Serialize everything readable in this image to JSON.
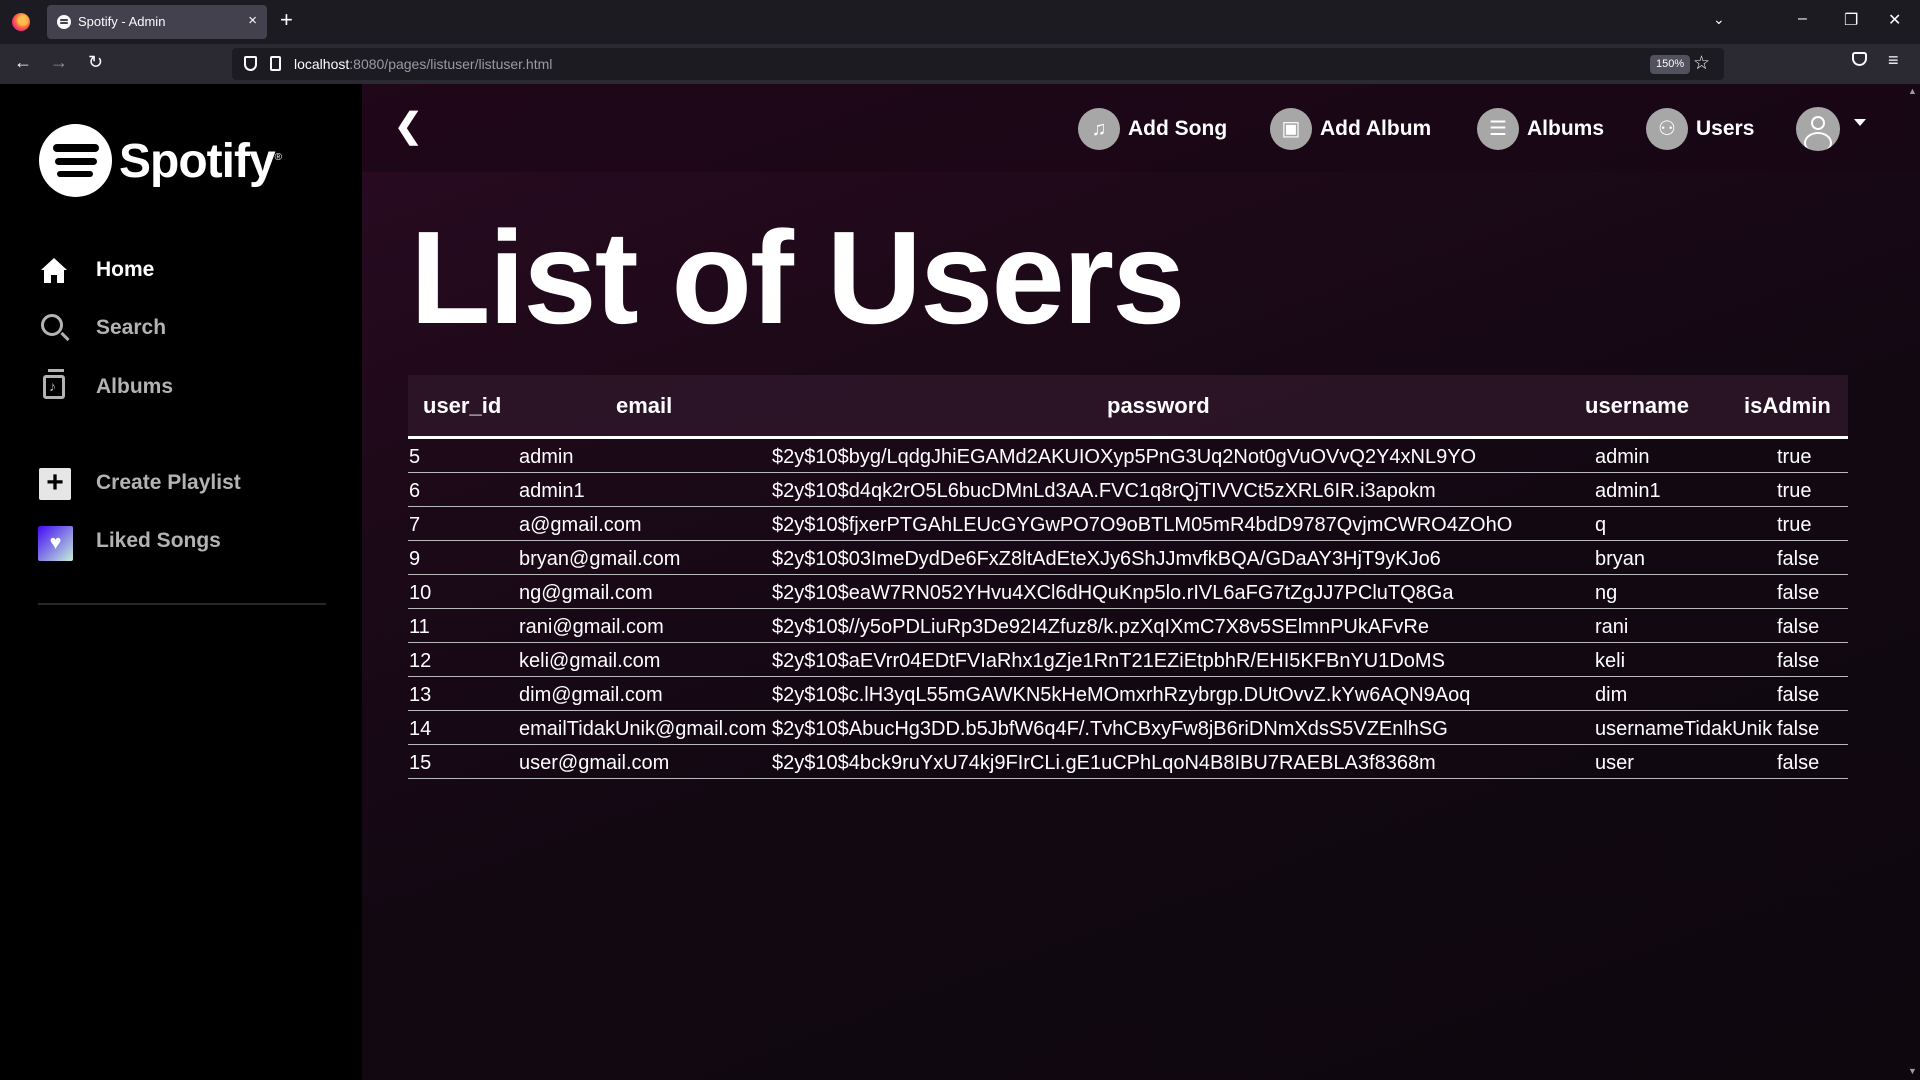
{
  "browser": {
    "tab_title": "Spotify - Admin",
    "url_host": "localhost",
    "url_rest": ":8080/pages/listuser/listuser.html",
    "zoom": "150%",
    "tab_close": "×",
    "new_tab": "+",
    "tab_list": "⌄",
    "win_min": "–",
    "win_restore": "❐",
    "win_close": "✕",
    "back": "←",
    "forward": "→",
    "reload": "↻",
    "bookmark": "☆",
    "menu": "≡"
  },
  "sidebar": {
    "logo_text": "Spotify",
    "logo_mark": "®",
    "items": [
      {
        "label": "Home",
        "icon": "home-icon"
      },
      {
        "label": "Search",
        "icon": "search-icon"
      },
      {
        "label": "Albums",
        "icon": "album-icon"
      },
      {
        "label": "Create Playlist",
        "icon": "plus-icon"
      },
      {
        "label": "Liked Songs",
        "icon": "heart-icon"
      }
    ],
    "plus_glyph": "+",
    "heart_glyph": "♥"
  },
  "topbar": {
    "back_glyph": "❮",
    "actions": [
      {
        "label": "Add Song",
        "icon": "music-note-icon",
        "glyph": "♫"
      },
      {
        "label": "Add Album",
        "icon": "album-icon",
        "glyph": "▣"
      },
      {
        "label": "Albums",
        "icon": "list-icon",
        "glyph": "☰"
      },
      {
        "label": "Users",
        "icon": "users-icon",
        "glyph": "⚇"
      }
    ]
  },
  "main": {
    "title": "List of Users"
  },
  "table": {
    "columns": [
      "user_id",
      "email",
      "password",
      "username",
      "isAdmin"
    ],
    "rows": [
      [
        "5",
        "admin",
        "$2y$10$byg/LqdgJhiEGAMd2AKUIOXyp5PnG3Uq2Not0gVuOVvQ2Y4xNL9YO",
        "admin",
        "true"
      ],
      [
        "6",
        "admin1",
        "$2y$10$d4qk2rO5L6bucDMnLd3AA.FVC1q8rQjTIVVCt5zXRL6IR.i3apokm",
        "admin1",
        "true"
      ],
      [
        "7",
        "a@gmail.com",
        "$2y$10$fjxerPTGAhLEUcGYGwPO7O9oBTLM05mR4bdD9787QvjmCWRO4ZOhO",
        "q",
        "true"
      ],
      [
        "9",
        "bryan@gmail.com",
        "$2y$10$03ImeDydDe6FxZ8ltAdEteXJy6ShJJmvfkBQA/GDaAY3HjT9yKJo6",
        "bryan",
        "false"
      ],
      [
        "10",
        "ng@gmail.com",
        "$2y$10$eaW7RN052YHvu4XCl6dHQuKnp5lo.rIVL6aFG7tZgJJ7PCluTQ8Ga",
        "ng",
        "false"
      ],
      [
        "11",
        "rani@gmail.com",
        "$2y$10$//y5oPDLiuRp3De92I4Zfuz8/k.pzXqIXmC7X8v5SElmnPUkAFvRe",
        "rani",
        "false"
      ],
      [
        "12",
        "keli@gmail.com",
        "$2y$10$aEVrr04EDtFVIaRhx1gZje1RnT21EZiEtpbhR/EHI5KFBnYU1DoMS",
        "keli",
        "false"
      ],
      [
        "13",
        "dim@gmail.com",
        "$2y$10$c.lH3yqL55mGAWKN5kHeMOmxrhRzybrgp.DUtOvvZ.kYw6AQN9Aoq",
        "dim",
        "false"
      ],
      [
        "14",
        "emailTidakUnik@gmail.com",
        "$2y$10$AbucHg3DD.b5JbfW6q4F/.TvhCBxyFw8jB6riDNmXdsS5VZEnlhSG",
        "usernameTidakUnik",
        "false"
      ],
      [
        "15",
        "user@gmail.com",
        "$2y$10$4bck9ruYxU74kj9FIrCLi.gE1uCPhLqoN4B8IBU7RAEBLA3f8368m",
        "user",
        "false"
      ]
    ]
  }
}
